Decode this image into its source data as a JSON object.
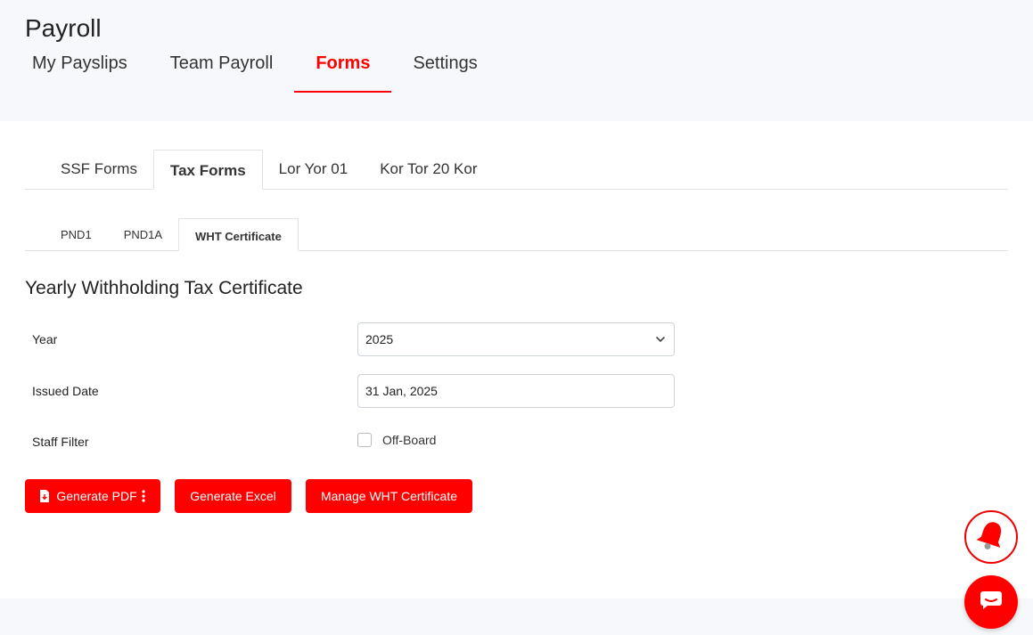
{
  "app": {
    "title": "Payroll"
  },
  "main_tabs": [
    {
      "label": "My Payslips",
      "active": false
    },
    {
      "label": "Team Payroll",
      "active": false
    },
    {
      "label": "Forms",
      "active": true
    },
    {
      "label": "Settings",
      "active": false
    }
  ],
  "form_tabs": [
    {
      "label": "SSF Forms",
      "active": false
    },
    {
      "label": "Tax Forms",
      "active": true
    },
    {
      "label": "Lor Yor 01",
      "active": false
    },
    {
      "label": "Kor Tor 20 Kor",
      "active": false
    }
  ],
  "sub_tabs": [
    {
      "label": "PND1",
      "active": false
    },
    {
      "label": "PND1A",
      "active": false
    },
    {
      "label": "WHT Certificate",
      "active": true
    }
  ],
  "section": {
    "title": "Yearly Withholding Tax Certificate"
  },
  "form": {
    "year_label": "Year",
    "year_value": "2025",
    "issued_date_label": "Issued Date",
    "issued_date_value": "31 Jan, 2025",
    "staff_filter_label": "Staff Filter",
    "off_board_label": "Off-Board",
    "off_board_checked": false
  },
  "actions": {
    "generate_pdf": "Generate PDF",
    "generate_excel": "Generate Excel",
    "manage_wht": "Manage WHT Certificate"
  },
  "colors": {
    "accent": "#ff0000",
    "header_bg": "#f7f8fb"
  },
  "icons": {
    "pdf": "file-download-icon",
    "more": "kebab-menu-icon",
    "bell": "bell-icon",
    "chat": "chat-icon",
    "dropdown": "chevron-down-icon"
  }
}
